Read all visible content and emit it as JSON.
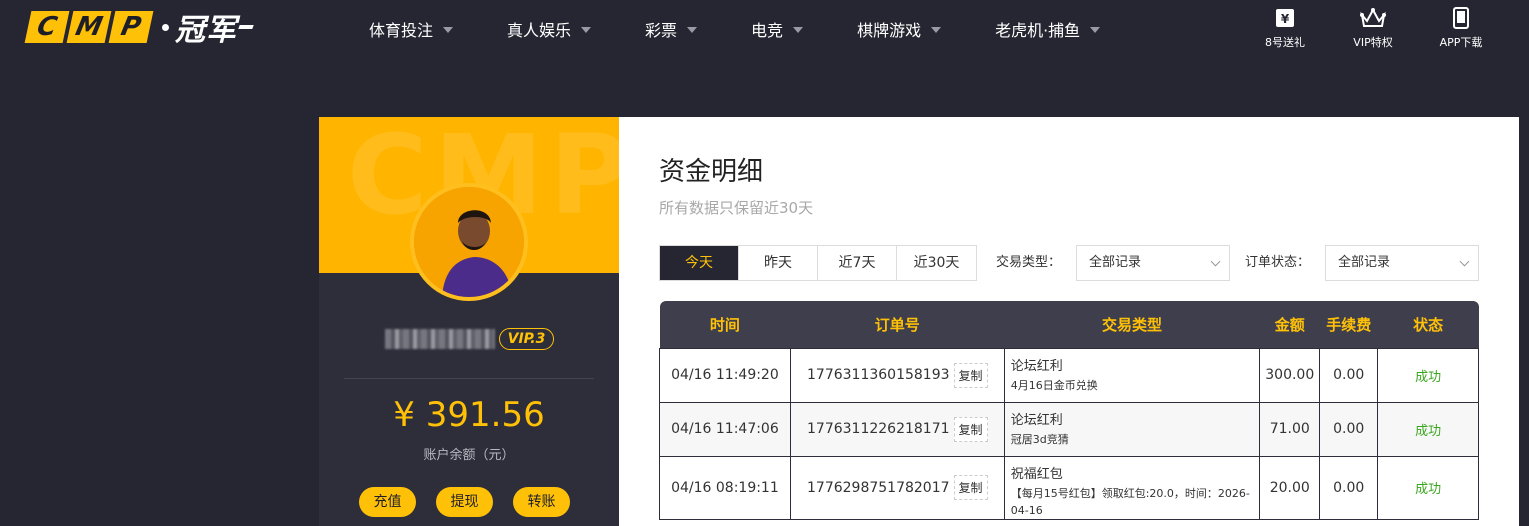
{
  "logo": {
    "letters": [
      "C",
      "M",
      "P"
    ],
    "cn": "冠军"
  },
  "nav": [
    {
      "label": "体育投注"
    },
    {
      "label": "真人娱乐"
    },
    {
      "label": "彩票"
    },
    {
      "label": "电竞"
    },
    {
      "label": "棋牌游戏"
    },
    {
      "label": "老虎机·捕鱼"
    }
  ],
  "tools": [
    {
      "label": "8号送礼",
      "icon": "ticket-icon"
    },
    {
      "label": "VIP特权",
      "icon": "crown-icon"
    },
    {
      "label": "APP下载",
      "icon": "tablet-icon"
    }
  ],
  "profile": {
    "watermark": "CMP",
    "vip": "VIP.3",
    "balance": "¥ 391.56",
    "balance_label": "账户余额（元）",
    "actions": [
      "充值",
      "提现",
      "转账"
    ]
  },
  "page": {
    "title": "资金明细",
    "subtitle": "所有数据只保留近30天"
  },
  "filters": {
    "tabs": [
      "今天",
      "昨天",
      "近7天",
      "近30天"
    ],
    "active_tab": "今天",
    "type_label": "交易类型：",
    "type_value": "全部记录",
    "status_label": "订单状态：",
    "status_value": "全部记录"
  },
  "table": {
    "headers": [
      "时间",
      "订单号",
      "交易类型",
      "金额",
      "手续费",
      "状态"
    ],
    "copy_label": "复制",
    "rows": [
      {
        "time": "04/16 11:49:20",
        "order": "1776311360158193",
        "type": "论坛红利",
        "type_detail": "4月16日金币兑换",
        "amount": "300.00",
        "fee": "0.00",
        "status": "成功"
      },
      {
        "time": "04/16 11:47:06",
        "order": "1776311226218171",
        "type": "论坛红利",
        "type_detail": "冠居3d竞猜",
        "amount": "71.00",
        "fee": "0.00",
        "status": "成功"
      },
      {
        "time": "04/16 08:19:11",
        "order": "1776298751782017",
        "type": "祝福红包",
        "type_detail": "【每月15号红包】领取红包:20.0，时间：2026-04-16",
        "amount": "20.00",
        "fee": "0.00",
        "status": "成功"
      }
    ]
  },
  "colors": {
    "accent": "#ffc107",
    "bg": "#262632",
    "success": "#3aa51e"
  }
}
